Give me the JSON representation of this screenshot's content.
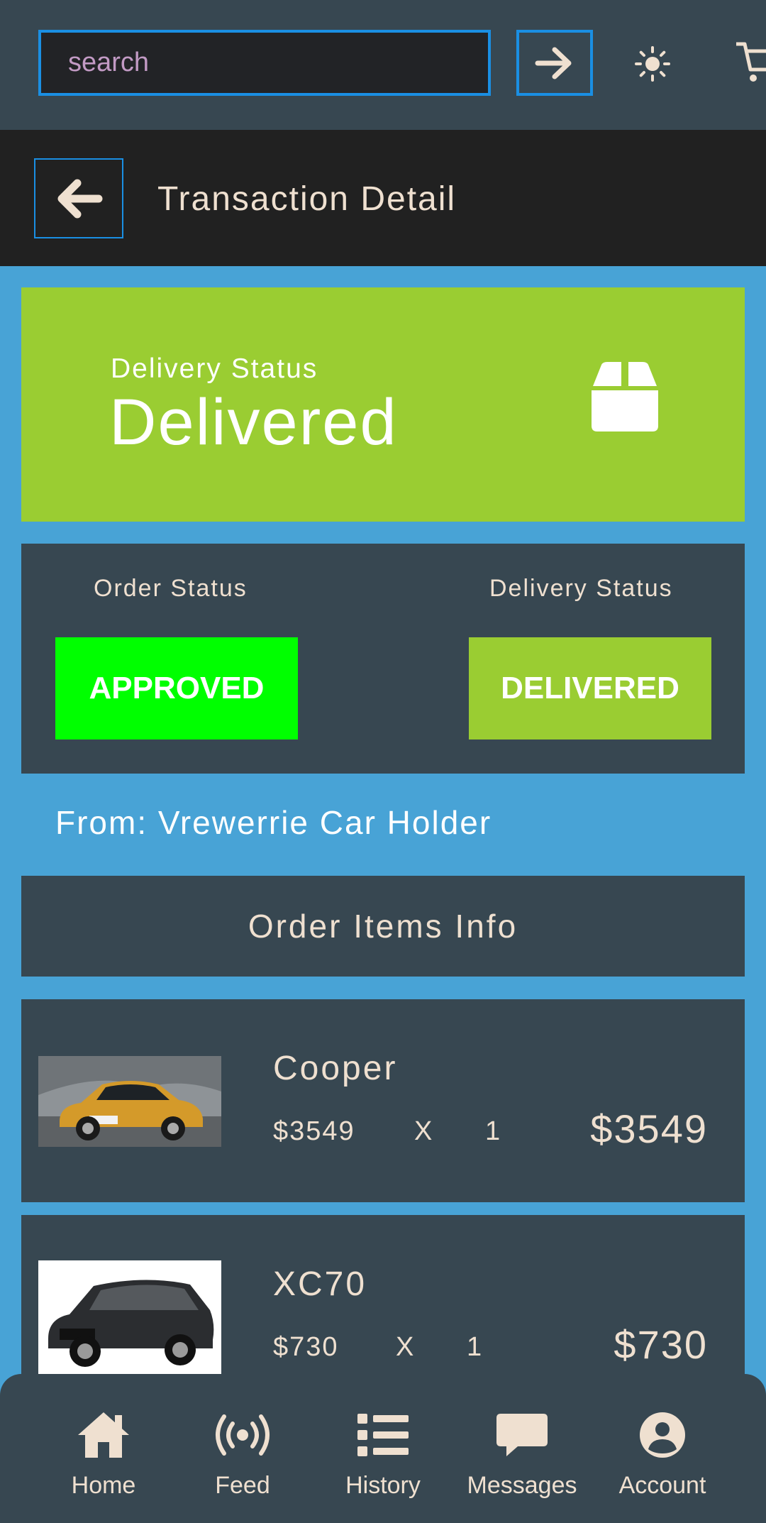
{
  "search": {
    "placeholder": "search"
  },
  "header": {
    "title": "Transaction Detail"
  },
  "delivery_hero": {
    "label": "Delivery Status",
    "value": "Delivered"
  },
  "status_panel": {
    "order_label": "Order Status",
    "order_value": "APPROVED",
    "delivery_label": "Delivery Status",
    "delivery_value": "DELIVERED"
  },
  "from": "From: Vrewerrie Car Holder",
  "items_header": "Order Items Info",
  "items": [
    {
      "name": "Cooper",
      "price": "$3549",
      "x": "X",
      "qty": "1",
      "total": "$3549"
    },
    {
      "name": "XC70",
      "price": "$730",
      "x": "X",
      "qty": "1",
      "total": "$730"
    }
  ],
  "nav": [
    {
      "label": "Home",
      "icon": "home-icon"
    },
    {
      "label": "Feed",
      "icon": "broadcast-icon"
    },
    {
      "label": "History",
      "icon": "list-icon"
    },
    {
      "label": "Messages",
      "icon": "message-icon"
    },
    {
      "label": "Account",
      "icon": "account-icon"
    }
  ],
  "colors": {
    "topbar": "#374751",
    "header": "#212121",
    "background": "#48a3d6",
    "accent_border": "#1a8fe3",
    "delivered_green": "#9acd32",
    "approved_green": "#00ff00",
    "text_cream": "#efe0d0"
  }
}
